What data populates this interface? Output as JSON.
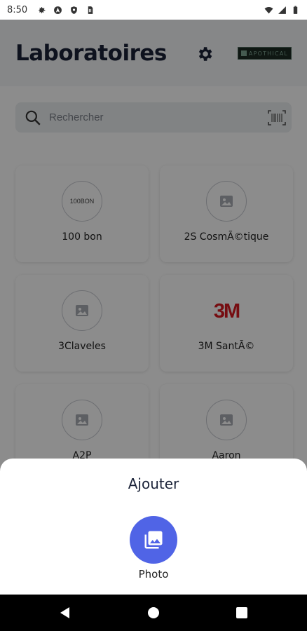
{
  "status_bar": {
    "time": "8:50",
    "left_icons": [
      "gear-icon",
      "location-icon",
      "shield-icon",
      "sim-card-icon"
    ],
    "right_icons": [
      "wifi-icon",
      "cellular-icon",
      "battery-icon"
    ]
  },
  "header": {
    "title": "Laboratoires",
    "settings_icon": "gear-icon",
    "brand_logo_text": "APOTHICAL"
  },
  "search": {
    "placeholder": "Rechercher",
    "icon": "search-icon",
    "scan_icon": "barcode-scan-icon"
  },
  "labs": [
    {
      "name": "100 bon",
      "logo": "100BON"
    },
    {
      "name": "2S CosmÃ©tique",
      "logo": "image-placeholder-icon"
    },
    {
      "name": "3Claveles",
      "logo": "image-placeholder-icon"
    },
    {
      "name": "3M SantÃ©",
      "logo": "3M"
    },
    {
      "name": "A2P",
      "logo": "image-placeholder-icon"
    },
    {
      "name": "Aaron",
      "logo": "image-placeholder-icon"
    }
  ],
  "sheet": {
    "title": "Ajouter",
    "photo_label": "Photo",
    "photo_icon": "photo-library-icon"
  },
  "colors": {
    "accent": "#5064e6",
    "brand_red": "#d71920",
    "title": "#1a2238"
  },
  "nav": {
    "back_icon": "back-icon",
    "home_icon": "home-icon",
    "recents_icon": "recents-icon"
  }
}
